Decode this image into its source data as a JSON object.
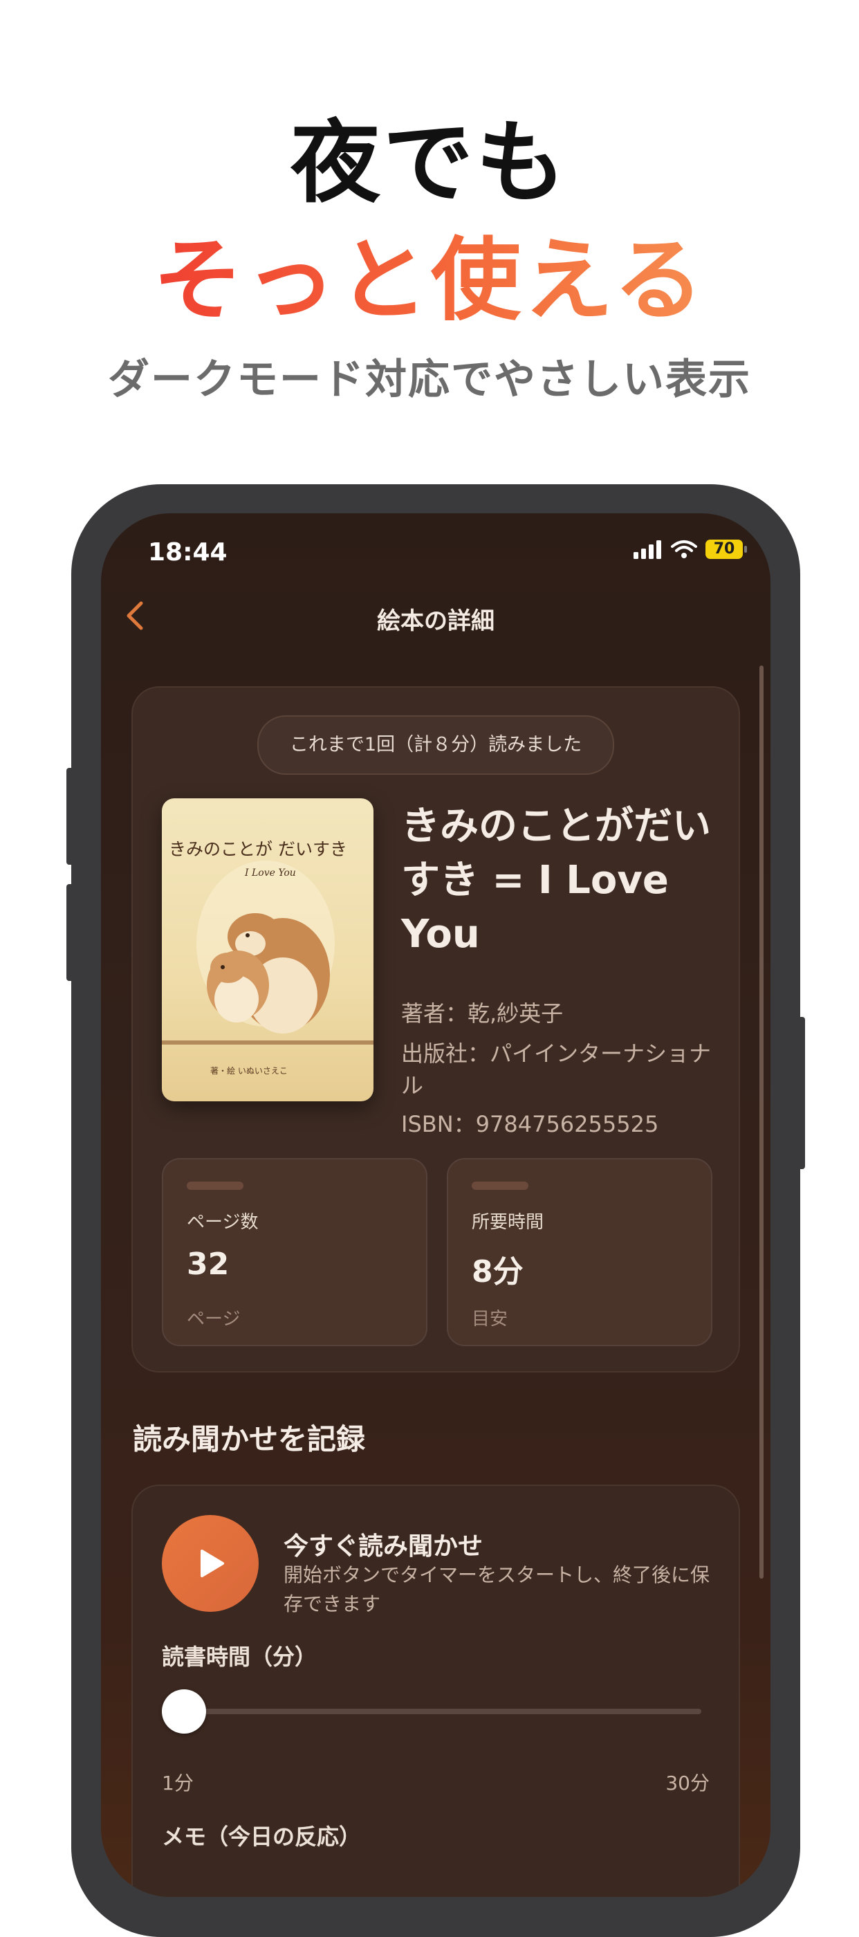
{
  "promo": {
    "title_line1": "夜でも",
    "title_line2": "そっと使える",
    "subtitle": "ダークモード対応でやさしい表示"
  },
  "status_bar": {
    "time": "18:44",
    "battery": "70",
    "battery_color": "#f5d10b"
  },
  "nav": {
    "back_icon": "chevron-left-icon",
    "title": "絵本の詳細",
    "accent_color": "#e07a3c"
  },
  "book": {
    "read_summary": "これまで1回（計８分）読みました",
    "cover": {
      "title_text": "きみのことが だいすき",
      "subtitle_text": "I Love You",
      "credit_text": "著・絵 いぬいさえこ"
    },
    "title": "きみのことがだいすき = I Love You",
    "author": "著者：乾,紗英子",
    "publisher": "出版社：パイインターナショナル",
    "isbn": "ISBN：9784756255525",
    "stats": [
      {
        "label": "ページ数",
        "value": "32",
        "unit": "ページ"
      },
      {
        "label": "所要時間",
        "value": "8分",
        "unit": "目安"
      }
    ]
  },
  "record": {
    "section_title": "読み聞かせを記録",
    "play_icon": "play-icon",
    "now_title": "今すぐ読み聞かせ",
    "now_desc": "開始ボタンでタイマーをスタートし、終了後に保存できます",
    "duration_label": "読書時間（分）",
    "slider_min_label": "1分",
    "slider_max_label": "30分",
    "slider_value_minutes": 1,
    "memo_label": "メモ（今日の反応）"
  }
}
